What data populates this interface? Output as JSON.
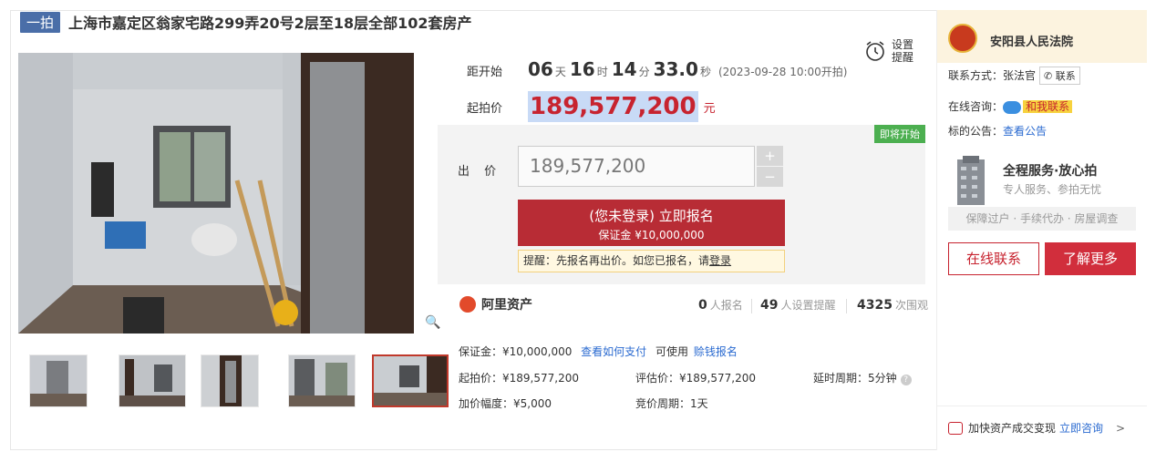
{
  "title": {
    "tag": "一拍",
    "text": "上海市嘉定区翁家宅路299弄20号2层至18层全部102套房产"
  },
  "countdown": {
    "label": "距开始",
    "days": "06",
    "days_unit": "天",
    "hours": "16",
    "hours_unit": "时",
    "minutes": "14",
    "minutes_unit": "分",
    "seconds": "33.0",
    "seconds_unit": "秒",
    "start_text": "(2023-09-28 10:00开拍)"
  },
  "reminder": {
    "label_line1": "设置",
    "label_line2": "提醒"
  },
  "start_price": {
    "label": "起拍价",
    "value": "189,577,200",
    "unit": "元"
  },
  "bid": {
    "status_badge": "即将开始",
    "label": "出 价",
    "input_value": "189,577,200",
    "plus": "+",
    "minus": "−",
    "signup_line1": "(您未登录) 立即报名",
    "signup_line2": "保证金 ¥10,000,000",
    "tip_prefix": "提醒：先报名再出价。如您已报名，请",
    "tip_link": "登录"
  },
  "platform": {
    "name": "阿里资产"
  },
  "stats": {
    "signups": "0",
    "signups_label": "人报名",
    "reminders": "49",
    "reminders_label": "人设置提醒",
    "views": "4325",
    "views_label": "次围观"
  },
  "info": {
    "deposit": "保证金：¥10,000,000",
    "how_pay": "查看如何支付",
    "can_use": "可使用",
    "loan": "赊钱报名",
    "start_price": "起拍价：¥189,577,200",
    "appraisal": "评估价：¥189,577,200",
    "delay": "延时周期：5分钟",
    "increment": "加价幅度：¥5,000",
    "cycle": "竞价周期：1天"
  },
  "court": {
    "name": "安阳县人民法院",
    "contact_label": "联系方式：张法官",
    "contact_btn": "联系",
    "consult_label": "在线咨询：",
    "consult_link": "和我联系",
    "notice_label": "标的公告：",
    "notice_link": "查看公告"
  },
  "service": {
    "title": "全程服务·放心拍",
    "subtitle": "专人服务、参拍无忧",
    "bar": "保障过户 · 手续代办 · 房屋调查",
    "btn_contact": "在线联系",
    "btn_more": "了解更多"
  },
  "footer": {
    "text": "加快资产成交变现",
    "link": "立即咨询",
    "arrow": ">"
  },
  "colors": {
    "accent_red": "#c7232f",
    "link_blue": "#2a6ad0",
    "tag_blue": "#4a6ea8"
  }
}
